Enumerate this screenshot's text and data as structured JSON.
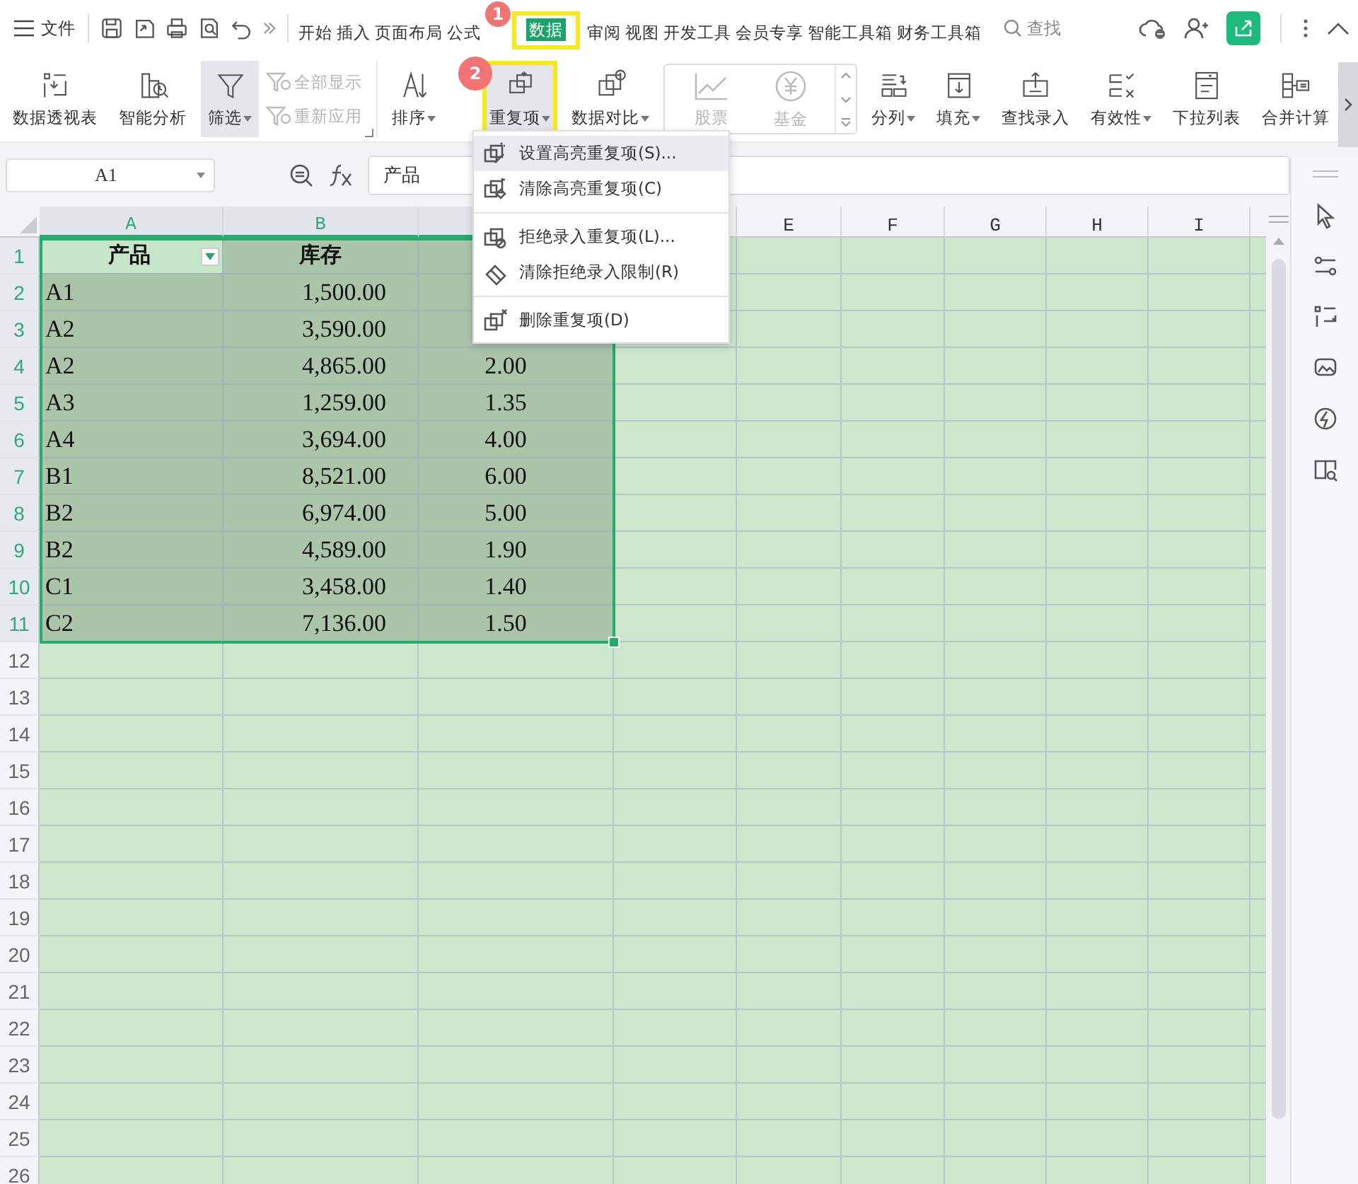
{
  "menu_bar": {
    "file_label": "文件",
    "search_placeholder": "查找",
    "tabs": [
      {
        "label": "开始",
        "selected": false
      },
      {
        "label": "插入",
        "selected": false
      },
      {
        "label": "页面布局",
        "selected": false
      },
      {
        "label": "公式",
        "selected": false
      },
      {
        "label": "数据",
        "selected": true,
        "badge": "1",
        "outlined": true
      },
      {
        "label": "审阅",
        "selected": false
      },
      {
        "label": "视图",
        "selected": false
      },
      {
        "label": "开发工具",
        "selected": false
      },
      {
        "label": "会员专享",
        "selected": false
      },
      {
        "label": "智能工具箱",
        "selected": false
      },
      {
        "label": "财务工具箱",
        "selected": false
      }
    ]
  },
  "ribbon": [
    {
      "kind": "large",
      "label": "数据透视表",
      "caret": false,
      "pressed": false
    },
    {
      "kind": "large",
      "label": "智能分析",
      "caret": false,
      "pressed": false
    },
    {
      "kind": "large",
      "label": "筛选",
      "caret": true,
      "pressed": true
    },
    {
      "kind": "stack",
      "items": [
        {
          "label": "全部显示",
          "disabled": true
        },
        {
          "label": "重新应用",
          "disabled": true
        }
      ]
    },
    {
      "kind": "large",
      "label": "排序",
      "caret": true,
      "pressed": false
    },
    {
      "kind": "large",
      "label": "重复项",
      "caret": true,
      "pressed": true,
      "badge": "2",
      "outlined": true
    },
    {
      "kind": "large",
      "label": "数据对比",
      "caret": true,
      "pressed": false
    },
    {
      "kind": "gallery",
      "items": [
        {
          "label": "股票",
          "disabled": true
        },
        {
          "label": "基金",
          "disabled": true
        }
      ]
    },
    {
      "kind": "large",
      "label": "分列",
      "caret": true,
      "pressed": false
    },
    {
      "kind": "large",
      "label": "填充",
      "caret": true,
      "pressed": false
    },
    {
      "kind": "large",
      "label": "查找录入",
      "caret": false,
      "pressed": false
    },
    {
      "kind": "large",
      "label": "有效性",
      "caret": true,
      "pressed": false
    },
    {
      "kind": "large",
      "label": "下拉列表",
      "caret": false,
      "pressed": false
    },
    {
      "kind": "large",
      "label": "合并计算",
      "caret": false,
      "pressed": false
    }
  ],
  "name_box": "A1",
  "formula": "产品",
  "columns": [
    {
      "label": "A",
      "selected": true
    },
    {
      "label": "B",
      "selected": true
    },
    {
      "selected": true
    },
    {
      "selected": false
    },
    {
      "label": "E",
      "selected": false
    },
    {
      "label": "F",
      "selected": false
    },
    {
      "label": "G",
      "selected": false
    },
    {
      "label": "H",
      "selected": false
    },
    {
      "label": "I",
      "selected": false
    }
  ],
  "rows": [
    {
      "number": "1",
      "kind": "header",
      "selected": true,
      "filter": true,
      "cells": [
        "产品",
        "库存"
      ]
    },
    {
      "number": "2",
      "kind": "data",
      "selected": true,
      "cells": [
        "A1",
        "1,500.00"
      ]
    },
    {
      "number": "3",
      "kind": "data",
      "selected": true,
      "cells": [
        "A2",
        "3,590.00"
      ]
    },
    {
      "number": "4",
      "kind": "data",
      "selected": true,
      "cells": [
        "A2",
        "4,865.00",
        "2.00"
      ]
    },
    {
      "number": "5",
      "kind": "data",
      "selected": true,
      "cells": [
        "A3",
        "1,259.00",
        "1.35"
      ]
    },
    {
      "number": "6",
      "kind": "data",
      "selected": true,
      "cells": [
        "A4",
        "3,694.00",
        "4.00"
      ]
    },
    {
      "number": "7",
      "kind": "data",
      "selected": true,
      "cells": [
        "B1",
        "8,521.00",
        "6.00"
      ]
    },
    {
      "number": "8",
      "kind": "data",
      "selected": true,
      "cells": [
        "B2",
        "6,974.00",
        "5.00"
      ]
    },
    {
      "number": "9",
      "kind": "data",
      "selected": true,
      "cells": [
        "B2",
        "4,589.00",
        "1.90"
      ]
    },
    {
      "number": "10",
      "kind": "data",
      "selected": true,
      "cells": [
        "C1",
        "3,458.00",
        "1.40"
      ]
    },
    {
      "number": "11",
      "kind": "data",
      "selected": true,
      "cells": [
        "C2",
        "7,136.00",
        "1.50"
      ]
    },
    {
      "number": "12",
      "kind": "empty",
      "selected": false
    },
    {
      "number": "13",
      "kind": "empty",
      "selected": false
    },
    {
      "number": "14",
      "kind": "empty",
      "selected": false
    },
    {
      "number": "15",
      "kind": "empty",
      "selected": false
    },
    {
      "number": "16",
      "kind": "empty",
      "selected": false
    },
    {
      "number": "17",
      "kind": "empty",
      "selected": false
    },
    {
      "number": "18",
      "kind": "empty",
      "selected": false
    },
    {
      "number": "19",
      "kind": "empty",
      "selected": false
    },
    {
      "number": "20",
      "kind": "empty",
      "selected": false
    },
    {
      "number": "21",
      "kind": "empty",
      "selected": false
    },
    {
      "number": "22",
      "kind": "empty",
      "selected": false
    },
    {
      "number": "23",
      "kind": "empty",
      "selected": false
    },
    {
      "number": "24",
      "kind": "empty",
      "selected": false
    },
    {
      "number": "25",
      "kind": "empty",
      "selected": false
    },
    {
      "number": "26",
      "kind": "empty",
      "selected": false
    }
  ],
  "dropdown_menu": {
    "groups": [
      [
        {
          "label": "设置高亮重复项(S)...",
          "selected": true
        },
        {
          "label": "清除高亮重复项(C)",
          "selected": false
        }
      ],
      [
        {
          "label": "拒绝录入重复项(L)...",
          "selected": false
        },
        {
          "label": "清除拒绝录入限制(R)",
          "selected": false
        }
      ],
      [
        {
          "label": "删除重复项(D)",
          "selected": false
        }
      ]
    ]
  }
}
